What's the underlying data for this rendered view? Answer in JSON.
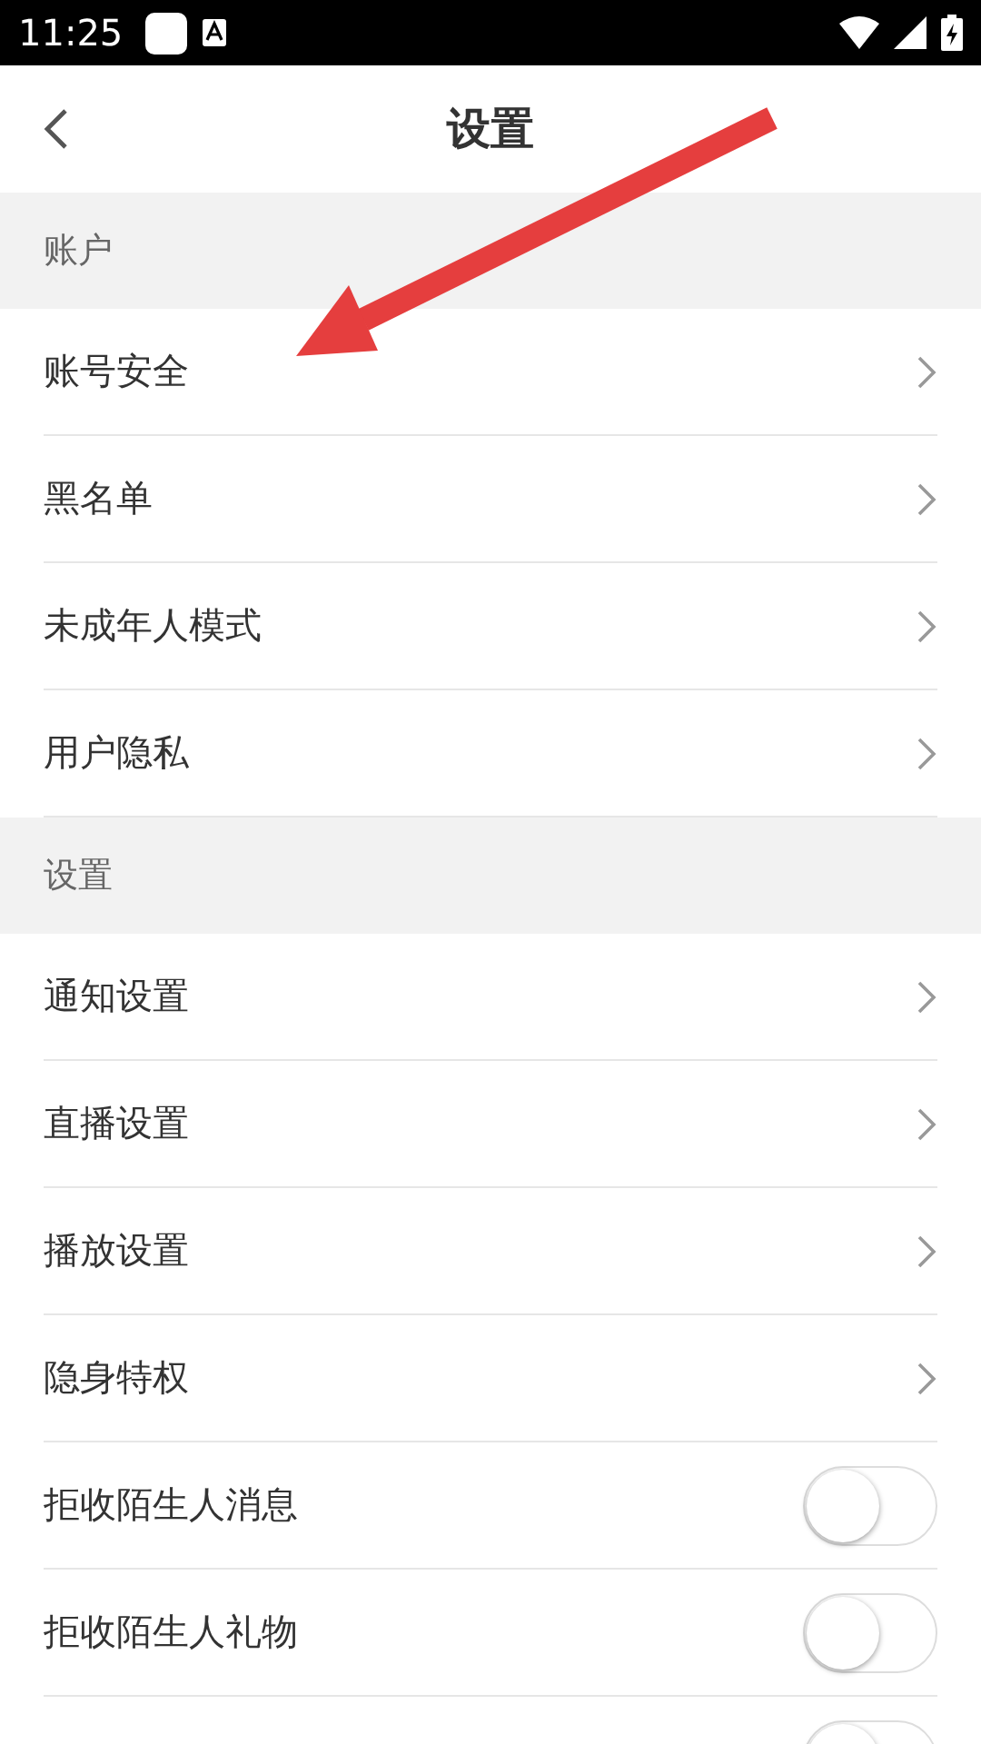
{
  "status_bar": {
    "time": "11:25"
  },
  "header": {
    "title": "设置"
  },
  "sections": [
    {
      "title": "账户",
      "items": [
        {
          "kind": "link",
          "label": "账号安全"
        },
        {
          "kind": "link",
          "label": "黑名单"
        },
        {
          "kind": "link",
          "label": "未成年人模式"
        },
        {
          "kind": "link",
          "label": "用户隐私"
        }
      ]
    },
    {
      "title": "设置",
      "items": [
        {
          "kind": "link",
          "label": "通知设置"
        },
        {
          "kind": "link",
          "label": "直播设置"
        },
        {
          "kind": "link",
          "label": "播放设置"
        },
        {
          "kind": "link",
          "label": "隐身特权"
        },
        {
          "kind": "toggle",
          "label": "拒收陌生人消息",
          "on": false
        },
        {
          "kind": "toggle",
          "label": "拒收陌生人礼物",
          "on": false
        },
        {
          "kind": "toggle",
          "on": false
        }
      ]
    }
  ]
}
